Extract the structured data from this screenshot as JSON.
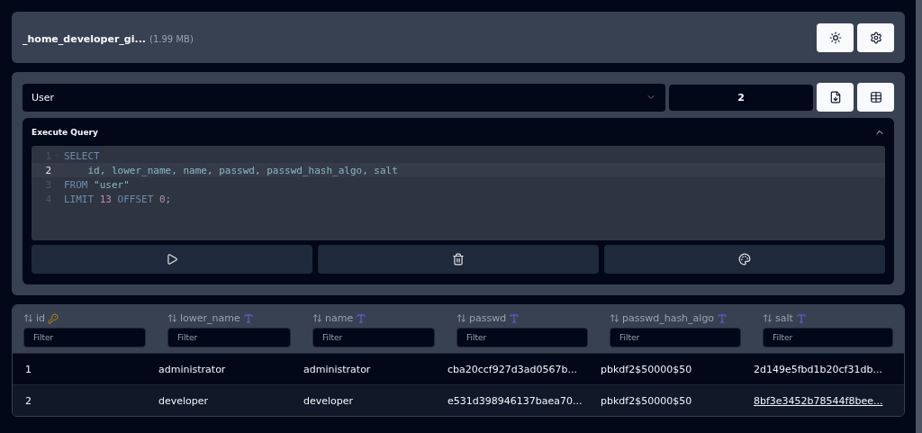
{
  "header": {
    "file_name": "_home_developer_gi...",
    "file_size": "(1.99 MB)"
  },
  "toolbar": {
    "table_select": {
      "value": "User"
    },
    "page_field": {
      "value": "2"
    }
  },
  "query_panel": {
    "title": "Execute Query",
    "expanded": true,
    "code_lines": [
      {
        "number": "1",
        "foldable": true,
        "active": false,
        "tokens": [
          {
            "kind": "keyword",
            "text": "SELECT"
          }
        ]
      },
      {
        "number": "2",
        "foldable": false,
        "active": true,
        "tokens": [
          {
            "kind": "plain",
            "text": "    id, lower_name, name, passwd, passwd_hash_algo, salt"
          }
        ]
      },
      {
        "number": "3",
        "foldable": false,
        "active": false,
        "tokens": [
          {
            "kind": "keyword",
            "text": "FROM"
          },
          {
            "kind": "plain",
            "text": " \"user\""
          }
        ]
      },
      {
        "number": "4",
        "foldable": false,
        "active": false,
        "tokens": [
          {
            "kind": "keyword",
            "text": "LIMIT"
          },
          {
            "kind": "number",
            "text": " 13"
          },
          {
            "kind": "keyword",
            "text": " OFFSET"
          },
          {
            "kind": "number",
            "text": " 0"
          },
          {
            "kind": "plain",
            "text": ";"
          }
        ]
      }
    ]
  },
  "table": {
    "columns": [
      {
        "name": "id",
        "kind": "key",
        "filter_placeholder": "Filter"
      },
      {
        "name": "lower_name",
        "kind": "text",
        "filter_placeholder": "Filter"
      },
      {
        "name": "name",
        "kind": "text",
        "filter_placeholder": "Filter"
      },
      {
        "name": "passwd",
        "kind": "text",
        "filter_placeholder": "Filter"
      },
      {
        "name": "passwd_hash_algo",
        "kind": "text",
        "filter_placeholder": "Filter"
      },
      {
        "name": "salt",
        "kind": "text",
        "filter_placeholder": "Filter"
      }
    ],
    "rows": [
      {
        "cells": [
          {
            "text": "1",
            "underlined": false
          },
          {
            "text": "administrator",
            "underlined": false
          },
          {
            "text": "administrator",
            "underlined": false
          },
          {
            "text": "cba20ccf927d3ad0567b...",
            "underlined": false
          },
          {
            "text": "pbkdf2$50000$50",
            "underlined": false
          },
          {
            "text": "2d149e5fbd1b20cf31db...",
            "underlined": false
          }
        ]
      },
      {
        "cells": [
          {
            "text": "2",
            "underlined": false
          },
          {
            "text": "developer",
            "underlined": false
          },
          {
            "text": "developer",
            "underlined": false
          },
          {
            "text": "e531d398946137baea70...",
            "underlined": false
          },
          {
            "text": "pbkdf2$50000$50",
            "underlined": false
          },
          {
            "text": "8bf3e3452b78544f8bee...",
            "underlined": true
          }
        ]
      }
    ]
  }
}
